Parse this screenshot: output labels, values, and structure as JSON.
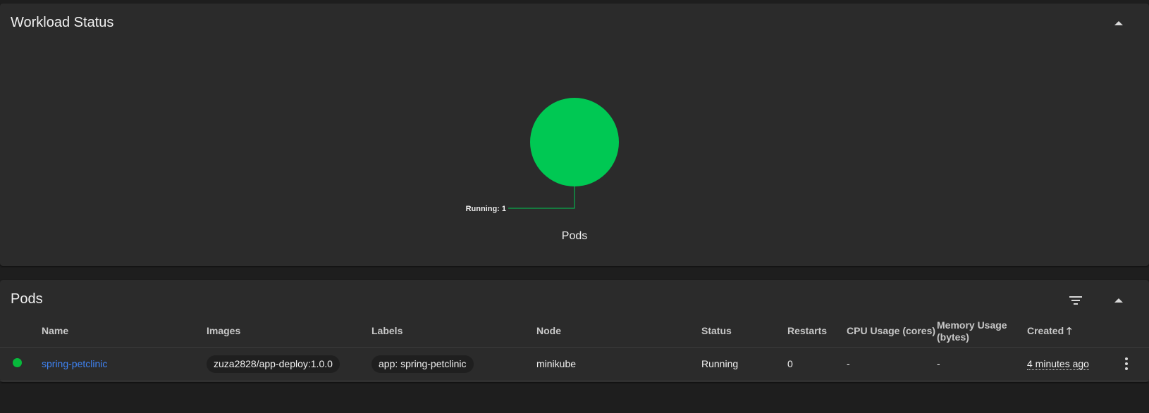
{
  "workload": {
    "title": "Workload Status",
    "chart_data": {
      "type": "pie",
      "title": "Pods",
      "slices": [
        {
          "label": "Running",
          "value": 1,
          "color": "#00c853"
        }
      ],
      "annotation": "Running: 1"
    }
  },
  "pods": {
    "title": "Pods",
    "columns": [
      "Name",
      "Images",
      "Labels",
      "Node",
      "Status",
      "Restarts",
      "CPU Usage (cores)",
      "Memory Usage (bytes)",
      "Created"
    ],
    "rows": [
      {
        "status_color": "#07b93b",
        "name": "spring-petclinic",
        "image": "zuza2828/app-deploy:1.0.0",
        "label": "app: spring-petclinic",
        "node": "minikube",
        "status": "Running",
        "restarts": "0",
        "cpu": "-",
        "memory": "-",
        "created": "4 minutes ago"
      }
    ],
    "sort_icon": "arrow-up-icon"
  },
  "icons": {
    "collapse": "chevron-up-icon",
    "filter": "filter-icon",
    "menu": "more-vert-icon"
  }
}
